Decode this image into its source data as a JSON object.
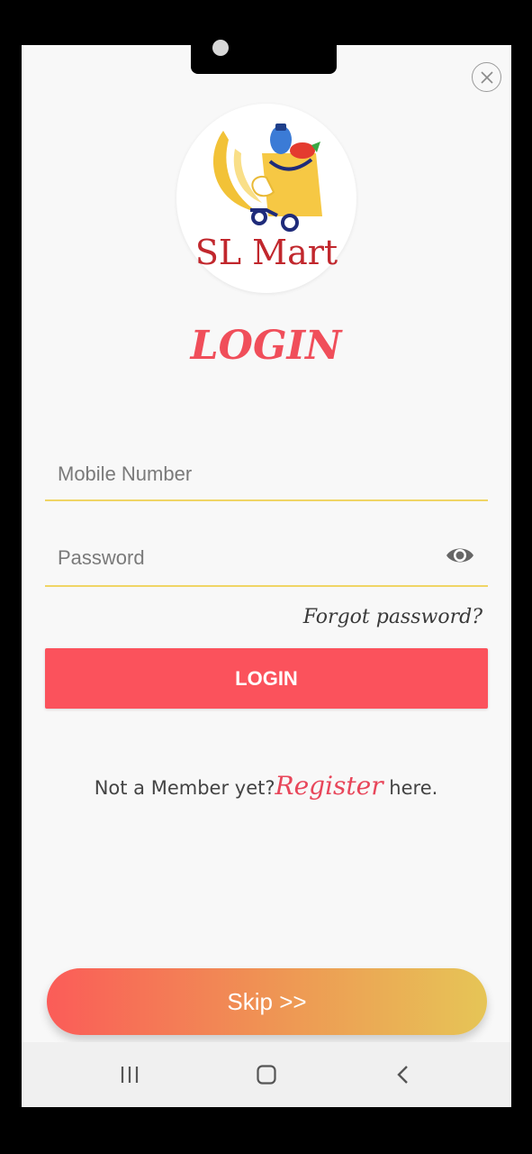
{
  "app": {
    "brand": "SL Mart",
    "title": "LOGIN"
  },
  "form": {
    "mobile_placeholder": "Mobile Number",
    "mobile_value": "",
    "password_placeholder": "Password",
    "password_value": "",
    "forgot_label": "Forgot password?",
    "login_label": "LOGIN"
  },
  "register": {
    "prefix": "Not a Member yet?",
    "link": "Register",
    "suffix": "here."
  },
  "skip_label": "Skip >>",
  "icons": {
    "close": "close-icon",
    "eye": "eye-icon",
    "logo": "shopping-cart-logo",
    "nav_recents": "recents-icon",
    "nav_home": "home-icon",
    "nav_back": "back-icon"
  },
  "colors": {
    "accent": "#fb525c",
    "title": "#f04e5a",
    "underline": "#f0d565",
    "brand_text": "#c1272d",
    "skip_gradient_start": "#fb5c58",
    "skip_gradient_end": "#e6c556"
  }
}
